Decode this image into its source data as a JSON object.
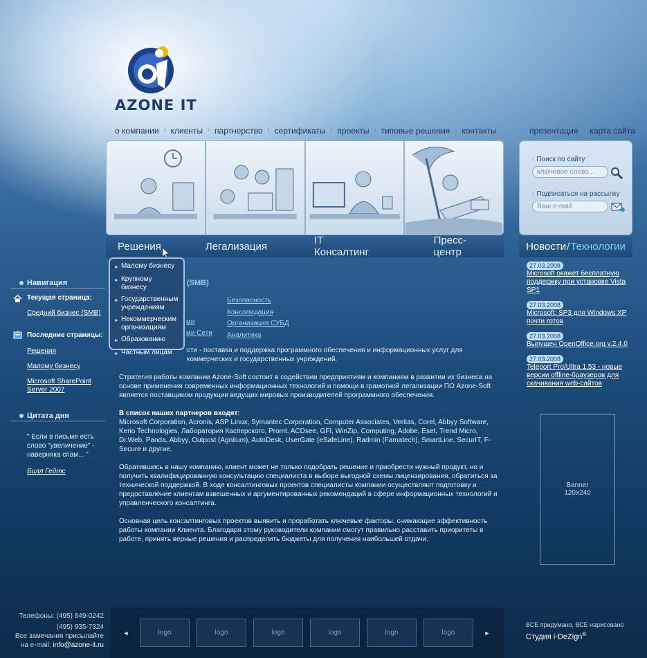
{
  "brand": {
    "name": "AZONE IT"
  },
  "top_nav": [
    "о компании",
    "клиенты",
    "партнерство",
    "сертификаты",
    "проекты",
    "типовые решения",
    "контакты"
  ],
  "top_nav_right": [
    "презентация",
    "карта сайта"
  ],
  "main_tabs": [
    "Решения",
    "Легализация",
    "IT Консалтинг",
    "Пресс-центр"
  ],
  "dropdown": [
    "Малому бизнесу",
    "Крупному бизнесу",
    "Государственным учреждениям",
    "Некоммерческим организациям",
    "Образованию",
    "Частным лицам"
  ],
  "sidebar": {
    "nav_title": "Навигация",
    "current_label": "Текущая страница:",
    "current_link": "Средний бизнес (SMB)",
    "recent_label": "Последние страницы:",
    "recent_links": [
      "Решения",
      "Малому бизнесу",
      "Microsoft SharePoint Server 2007"
    ],
    "quote_title": "Цитата дня",
    "quote_text": "\" Если в письме есть слово \"увеличение\" - наверняка спам... \"",
    "quote_author": "Билл Гейтс"
  },
  "content": {
    "heading_fragment": "(SMB)",
    "links_col1": [
      "ми",
      "ми Сети"
    ],
    "links_col2": [
      "Безопасность",
      "Консолидация",
      "Организация СУБД",
      "Аналитика"
    ],
    "para1": "сти - поставка и поддержка программного обеспечения и информационных услуг для коммерческих и государственных учреждений.",
    "para2": "Стратегия работы компании Azone-Soft состоит в содействии предприятиям и компаниям в развитии их бизнеса на основе применения современных информационных технологий и помощи в грамотной легализации ПО Azone-Soft является поставщиком продукции ведущих мировых производителей программного обеспечения.",
    "partners_title": "В список наших партнеров входят:",
    "partners_text": "Microsoft Corporation, Acronis, ASP Linux, Symantec Corporation, Computer Associates, Veritas, Corel, Abbyy Software, Kerio Technologies, Лаборатория Касперского, Promt, ACDsee, GFI, WinZip, Computing, Adobe, Eset, Trend Micro, Dr.Web, Panda, Abbyy, Outpost (Agnitum), AutoDesk, UserGate (eSafeLine), Radmin (Famatech), SmartLine, SecurIT, F-Secure и другие.",
    "para3": "Обратившись в нашу компанию, клиент может не только подобрать решение и приобрести нужный продукт, но и получить квалифицированную консультацию специалиста в выборе выгодной схемы лицензирования, обратиться за технической поддержкой. В ходе консалтинговых проектов специалисты компании осуществляют подготовку и предоставление клиентам взвешенных и аргументированных рекомендаций в сфере информационных технологий и управленческого консалтинга.",
    "para4": "Основная цель консалтинговых проектов выявить и проработать ключевые факторы, снижающие эффективность работы компании Клиента. Благодаря этому руководители компании смогут правильно расставить приоритеты в работе, принять верные решения и распределить бюджеты для получения наибольшей отдачи."
  },
  "right_panel": {
    "search_label": "Поиск по сайту",
    "search_placeholder": "ключевое слово...",
    "subscribe_label": "Подписаться на рассылку",
    "email_placeholder": "Ваш e-mail"
  },
  "news_tabs": {
    "left": "Новости",
    "sep": "/",
    "right": "Технологии"
  },
  "news": [
    {
      "date": "27.03.2008",
      "text": "Microsoft окажет бесплатную поддержку при установке Vista SP1"
    },
    {
      "date": "27.03.2008",
      "text": "Microsoft: SP3 для Windows XP почти готов"
    },
    {
      "date": "27.03.2008",
      "text": "Выпущен OpenOffice.org v.2.4.0"
    },
    {
      "date": "27.03.2008",
      "text": "Teleport Pro/Ultra 1.53 - новые версии offline-браузеров для скачивания web-сайтов"
    }
  ],
  "ad": {
    "line1": "Banner",
    "line2": "120x240"
  },
  "footer": {
    "phone1": "Телефоны: (495) 649-0242",
    "phone2": "(495) 935-7324",
    "note": "Все замечания присылайте",
    "email_prefix": "на e-mail:",
    "email": "info@azone-it.ru",
    "logos": [
      "logo",
      "logo",
      "logo",
      "logo",
      "logo",
      "logo"
    ],
    "credit": "ВСЕ придумано, ВСЕ нарисовано",
    "studio": "Студия i-DeZign",
    "studio_mark": "®"
  },
  "colors": {
    "accent": "#7fd2ff",
    "nav_text": "#1d3863",
    "link": "#a8d4f4"
  }
}
